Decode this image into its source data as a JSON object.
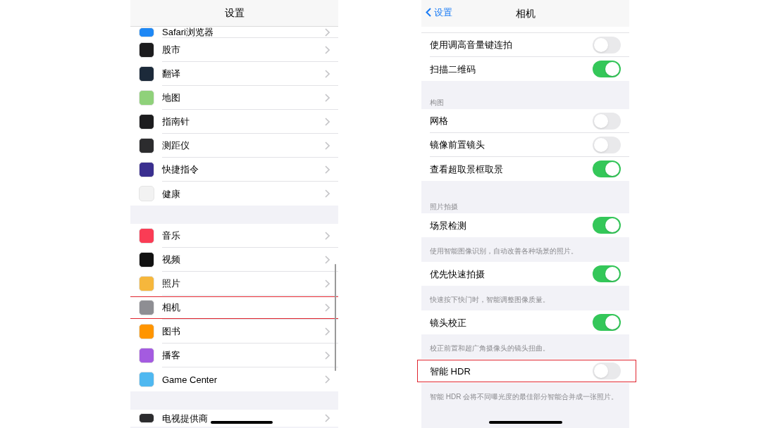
{
  "settings_screen": {
    "title": "设置",
    "groups": [
      {
        "items": [
          {
            "label": "Safari浏览器",
            "color": "#1e88f5",
            "highlighted": false,
            "cut": true
          },
          {
            "label": "股市",
            "color": "#1c1c1e",
            "highlighted": false
          },
          {
            "label": "翻译",
            "color": "#1c2a3a",
            "highlighted": false
          },
          {
            "label": "地图",
            "color": "#8fd17a",
            "highlighted": false
          },
          {
            "label": "指南针",
            "color": "#1c1c1e",
            "highlighted": false
          },
          {
            "label": "测距仪",
            "color": "#2c2c2e",
            "highlighted": false
          },
          {
            "label": "快捷指令",
            "color": "#3a2f8f",
            "highlighted": false
          },
          {
            "label": "健康",
            "color": "#f2f2f2",
            "highlighted": false
          }
        ]
      },
      {
        "items": [
          {
            "label": "音乐",
            "color": "#fa3c55",
            "highlighted": false
          },
          {
            "label": "视频",
            "color": "#111111",
            "highlighted": false
          },
          {
            "label": "照片",
            "color": "#f6b73c",
            "highlighted": false
          },
          {
            "label": "相机",
            "color": "#8e8e93",
            "highlighted": true
          },
          {
            "label": "图书",
            "color": "#ff9500",
            "highlighted": false
          },
          {
            "label": "播客",
            "color": "#a45be0",
            "highlighted": false
          },
          {
            "label": "Game Center",
            "color": "#4fb8f0",
            "highlighted": false
          }
        ]
      },
      {
        "items": [
          {
            "label": "电视提供商",
            "color": "#2c2c2e",
            "highlighted": false,
            "cut": true
          }
        ]
      }
    ]
  },
  "camera_screen": {
    "back": "设置",
    "title": "相机",
    "groups": [
      {
        "rows": [
          {
            "label": "使用调高音量键连拍",
            "on": false,
            "highlighted": false
          },
          {
            "label": "扫描二维码",
            "on": true,
            "highlighted": false
          }
        ]
      },
      {
        "header": "构图",
        "rows": [
          {
            "label": "网格",
            "on": false,
            "highlighted": false
          },
          {
            "label": "镜像前置镜头",
            "on": false,
            "highlighted": false
          },
          {
            "label": "查看超取景框取景",
            "on": true,
            "highlighted": false
          }
        ]
      },
      {
        "header": "照片拍摄",
        "rows": [
          {
            "label": "场景检测",
            "on": true,
            "highlighted": false,
            "note": "使用智能图像识别，自动改善各种场景的照片。"
          },
          {
            "label": "优先快速拍摄",
            "on": true,
            "highlighted": false,
            "note": "快速按下快门时，智能调整图像质量。"
          },
          {
            "label": "镜头校正",
            "on": true,
            "highlighted": false,
            "note": "校正前置和超广角摄像头的镜头扭曲。"
          },
          {
            "label": "智能 HDR",
            "on": false,
            "highlighted": true,
            "note": "智能 HDR 会将不同曝光度的最佳部分智能合并成一张照片。"
          }
        ]
      }
    ]
  }
}
